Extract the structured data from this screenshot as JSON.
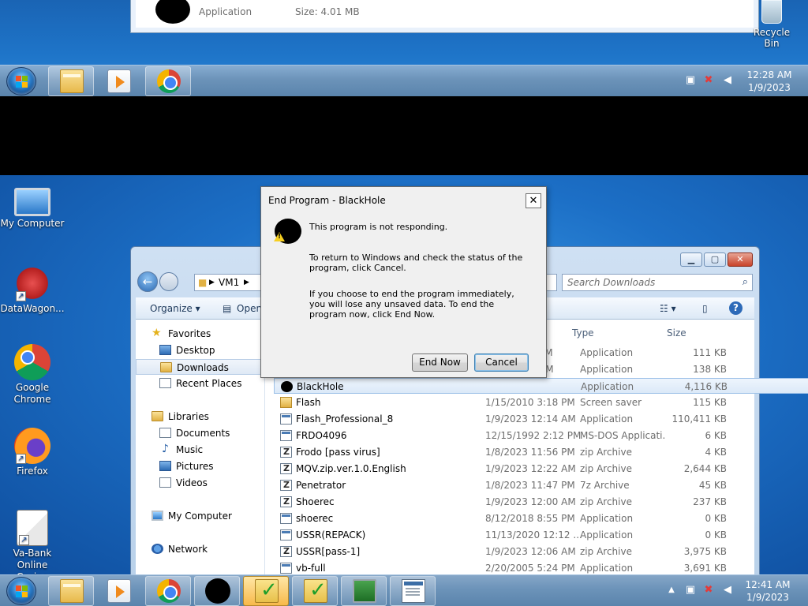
{
  "top_capture": {
    "file_type": "Application",
    "file_size": "Size: 4.01 MB",
    "recycle_bin": "Recycle Bin",
    "clock_time": "12:28 AM",
    "clock_date": "1/9/2023"
  },
  "desktop_icons": [
    {
      "label": "My Computer"
    },
    {
      "label": "DataWagon..."
    },
    {
      "label": "Google Chrome"
    },
    {
      "label": "Firefox"
    },
    {
      "label": "Va-Bank Online Casino"
    }
  ],
  "explorer": {
    "address_root": "VM1",
    "search_placeholder": "Search Downloads",
    "organize_label": "Organize ▾",
    "open_label": "Open",
    "nav": {
      "favorites": "Favorites",
      "desktop": "Desktop",
      "downloads": "Downloads",
      "recent": "Recent Places",
      "libraries": "Libraries",
      "documents": "Documents",
      "music": "Music",
      "pictures": "Pictures",
      "videos": "Videos",
      "my_computer": "My Computer",
      "network": "Network"
    },
    "columns": {
      "type": "Type",
      "size": "Size"
    },
    "files": [
      {
        "name": "",
        "date": "",
        "date_suffix": "PM",
        "type": "Application",
        "size": "111 KB",
        "icon": "app"
      },
      {
        "name": "",
        "date": "",
        "date_suffix": "AM",
        "type": "Application",
        "size": "138 KB",
        "icon": "app"
      },
      {
        "name": "BlackHole",
        "date": "",
        "date_suffix": "",
        "type": "Application",
        "size": "4,116 KB",
        "icon": "black"
      },
      {
        "name": "Flash",
        "date": "1/15/2010 3:18 PM",
        "date_suffix": "",
        "type": "Screen saver",
        "size": "115 KB",
        "icon": "folder"
      },
      {
        "name": "Flash_Professional_8",
        "date": "1/9/2023 12:14 AM",
        "date_suffix": "",
        "type": "Application",
        "size": "110,411 KB",
        "icon": "app"
      },
      {
        "name": "FRDO4096",
        "date": "12/15/1992 2:12 PM",
        "date_suffix": "",
        "type": "MS-DOS Applicati...",
        "size": "6 KB",
        "icon": "app"
      },
      {
        "name": "Frodo [pass virus]",
        "date": "1/8/2023 11:56 PM",
        "date_suffix": "",
        "type": "zip Archive",
        "size": "4 KB",
        "icon": "zip"
      },
      {
        "name": "MQV.zip.ver.1.0.English",
        "date": "1/9/2023 12:22 AM",
        "date_suffix": "",
        "type": "zip Archive",
        "size": "2,644 KB",
        "icon": "zip"
      },
      {
        "name": "Penetrator",
        "date": "1/8/2023 11:47 PM",
        "date_suffix": "",
        "type": "7z Archive",
        "size": "45 KB",
        "icon": "zip"
      },
      {
        "name": "Shoerec",
        "date": "1/9/2023 12:00 AM",
        "date_suffix": "",
        "type": "zip Archive",
        "size": "237 KB",
        "icon": "zip"
      },
      {
        "name": "shoerec",
        "date": "8/12/2018 8:55 PM",
        "date_suffix": "",
        "type": "Application",
        "size": "0 KB",
        "icon": "app"
      },
      {
        "name": "USSR(REPACK)",
        "date": "11/13/2020 12:12 ...",
        "date_suffix": "",
        "type": "Application",
        "size": "0 KB",
        "icon": "app"
      },
      {
        "name": "USSR[pass-1]",
        "date": "1/9/2023 12:06 AM",
        "date_suffix": "",
        "type": "zip Archive",
        "size": "3,975 KB",
        "icon": "zip"
      },
      {
        "name": "vb-full",
        "date": "2/20/2005 5:24 PM",
        "date_suffix": "",
        "type": "Application",
        "size": "3,691 KB",
        "icon": "app"
      }
    ]
  },
  "dialog": {
    "title": "End Program - BlackHole",
    "close_glyph": "✕",
    "line1": "This program is not responding.",
    "line2": "To return to Windows and check the status of the program, click Cancel.",
    "line3": "If you choose to end the program immediately, you will lose any unsaved data. To end the program now, click End Now.",
    "end_now": "End Now",
    "cancel": "Cancel"
  },
  "taskbar_bottom": {
    "clock_time": "12:41 AM",
    "clock_date": "1/9/2023"
  }
}
